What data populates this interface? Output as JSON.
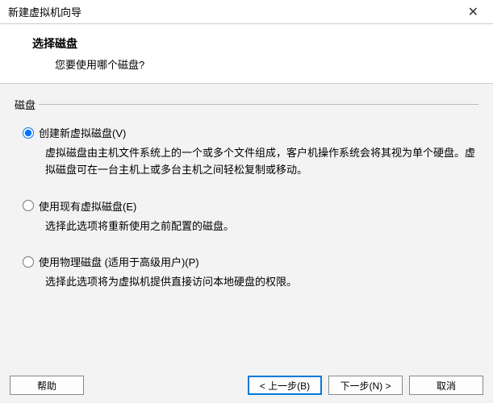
{
  "titlebar": {
    "title": "新建虚拟机向导"
  },
  "header": {
    "title": "选择磁盘",
    "subtitle": "您要使用哪个磁盘?"
  },
  "fieldset": {
    "label": "磁盘"
  },
  "options": [
    {
      "label": "创建新虚拟磁盘(V)",
      "desc": "虚拟磁盘由主机文件系统上的一个或多个文件组成，客户机操作系统会将其视为单个硬盘。虚拟磁盘可在一台主机上或多台主机之间轻松复制或移动。",
      "checked": true
    },
    {
      "label": "使用现有虚拟磁盘(E)",
      "desc": "选择此选项将重新使用之前配置的磁盘。",
      "checked": false
    },
    {
      "label": "使用物理磁盘 (适用于高级用户)(P)",
      "desc": "选择此选项将为虚拟机提供直接访问本地硬盘的权限。",
      "checked": false
    }
  ],
  "buttons": {
    "help": "帮助",
    "back": "< 上一步(B)",
    "next": "下一步(N) >",
    "cancel": "取消"
  }
}
